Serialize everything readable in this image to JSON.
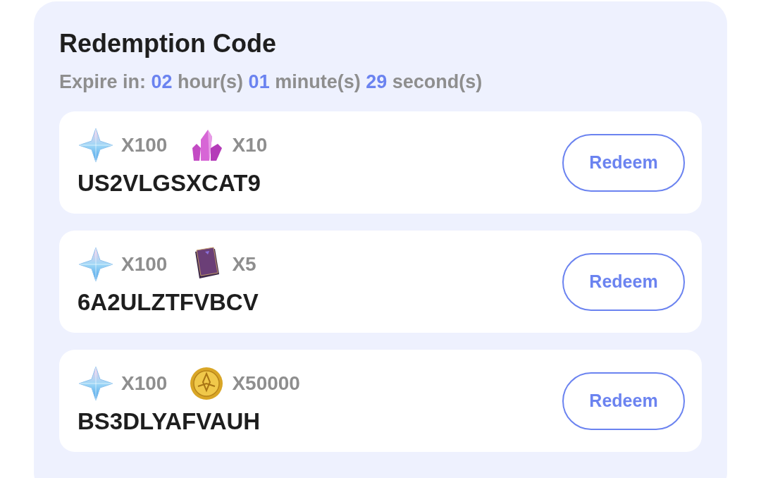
{
  "title": "Redemption Code",
  "countdown": {
    "label": "Expire in:",
    "parts": [
      {
        "value": "02",
        "unit": "hour(s)"
      },
      {
        "value": "01",
        "unit": "minute(s)"
      },
      {
        "value": "29",
        "unit": "second(s)"
      }
    ]
  },
  "codes": [
    {
      "rewards": [
        {
          "kind": "star",
          "quantity": "X100"
        },
        {
          "kind": "crystal",
          "quantity": "X10"
        }
      ],
      "code": "US2VLGSXCAT9",
      "button": "Redeem"
    },
    {
      "rewards": [
        {
          "kind": "star",
          "quantity": "X100"
        },
        {
          "kind": "book",
          "quantity": "X5"
        }
      ],
      "code": "6A2ULZTFVBCV",
      "button": "Redeem"
    },
    {
      "rewards": [
        {
          "kind": "star",
          "quantity": "X100"
        },
        {
          "kind": "coin",
          "quantity": "X50000"
        }
      ],
      "code": "BS3DLYAFVAUH",
      "button": "Redeem"
    }
  ]
}
